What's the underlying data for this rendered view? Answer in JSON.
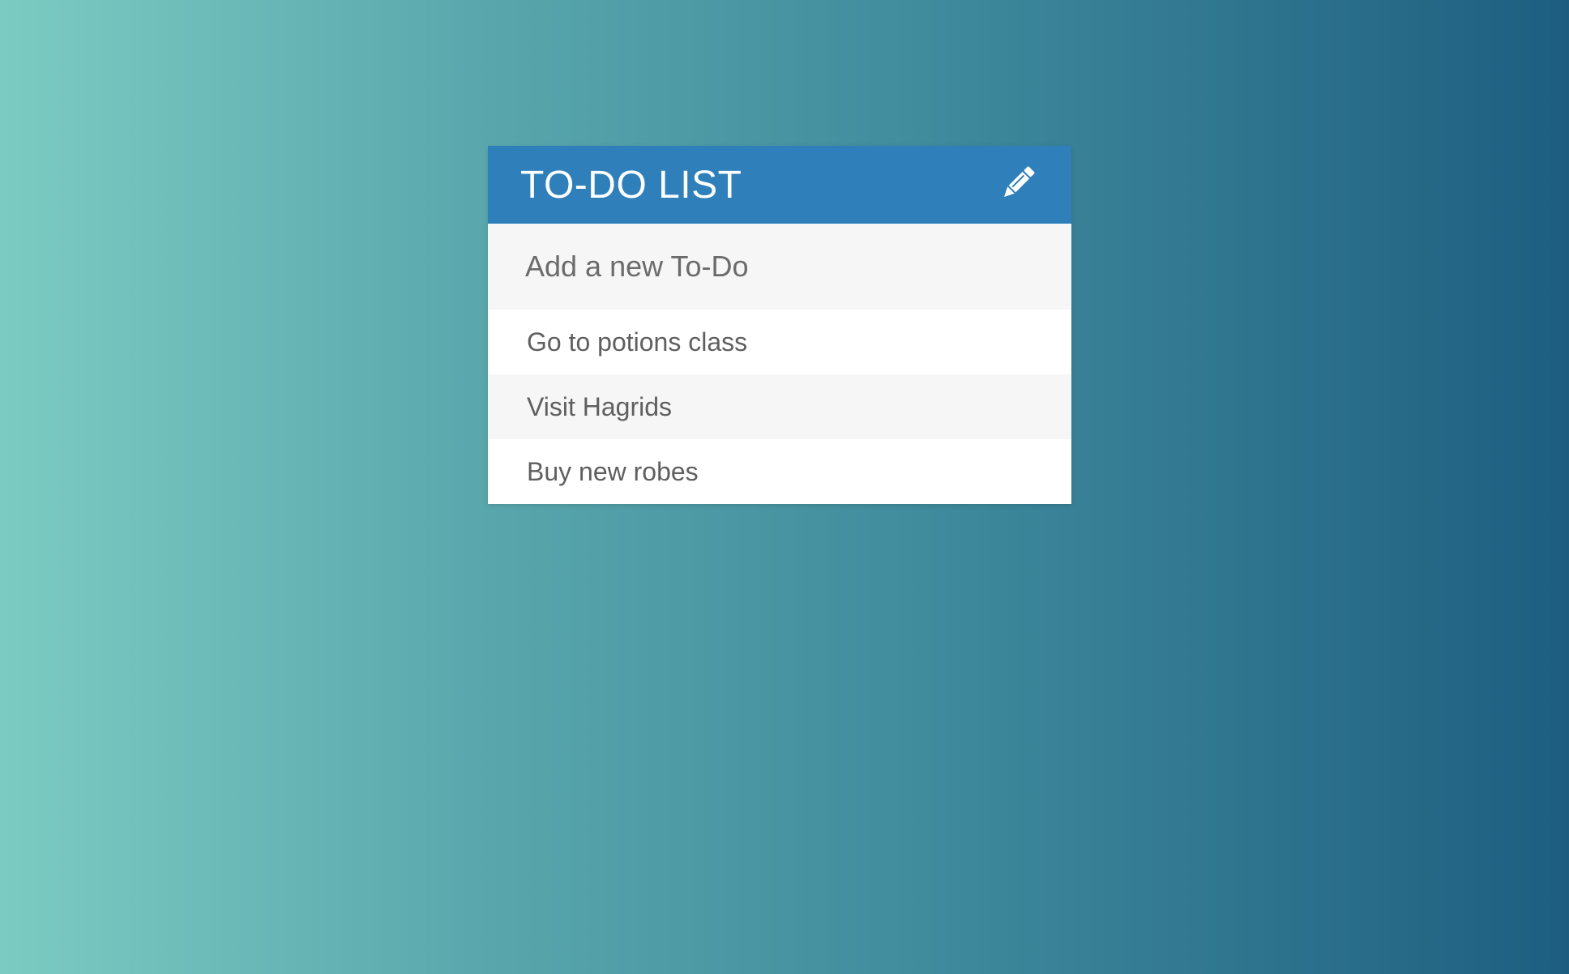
{
  "app": {
    "title": "TO-DO LIST",
    "edit_icon": "pencil-icon",
    "accent_color": "#2e7fba"
  },
  "new_todo": {
    "placeholder": "Add a new To-Do",
    "value": ""
  },
  "todos": [
    {
      "text": "Go to potions class"
    },
    {
      "text": "Visit Hagrids"
    },
    {
      "text": "Buy new robes"
    }
  ]
}
